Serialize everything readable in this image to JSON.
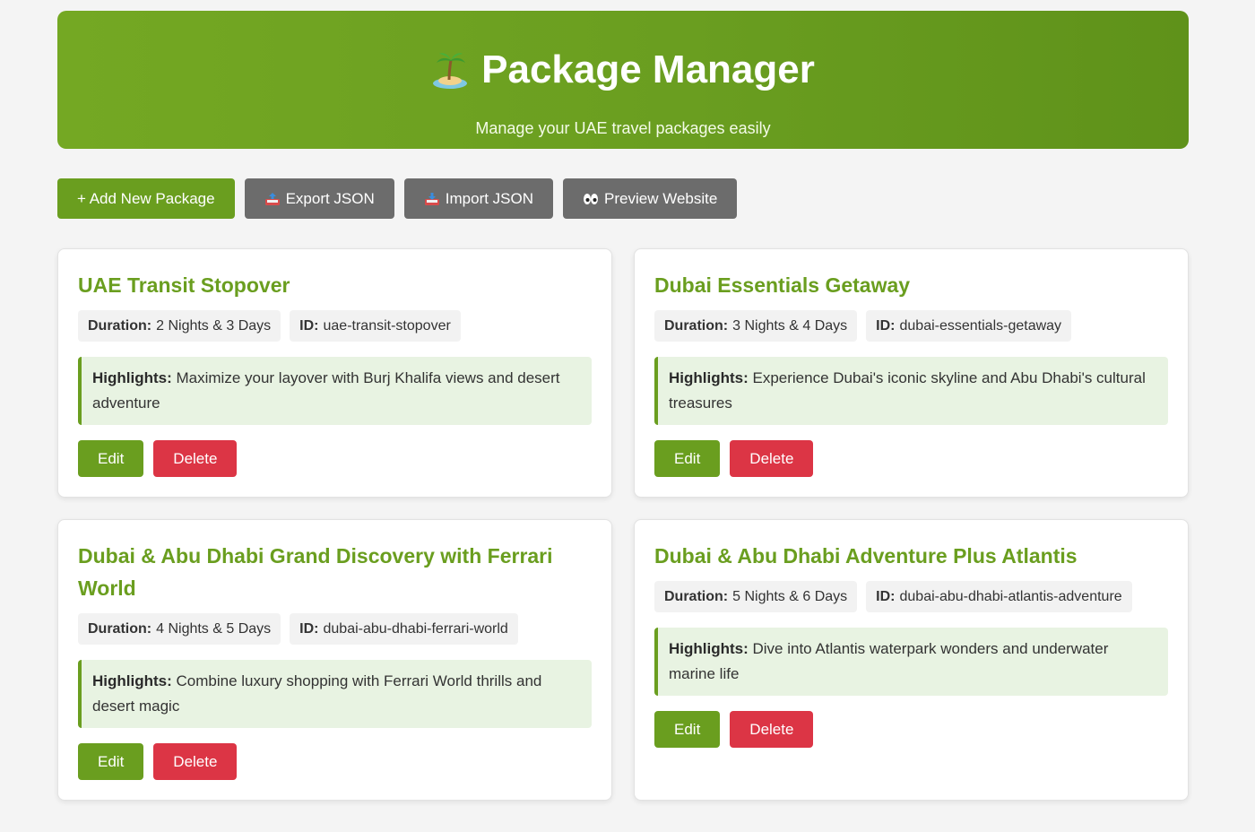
{
  "header": {
    "icon": "palm-island-icon",
    "title": "Package Manager",
    "subtitle": "Manage your UAE travel packages easily"
  },
  "toolbar": {
    "add_label": "+ Add New Package",
    "export_label": "Export JSON",
    "export_icon": "outbox-tray-icon",
    "import_label": "Import JSON",
    "import_icon": "inbox-tray-icon",
    "preview_label": "Preview Website",
    "preview_icon": "eyes-icon"
  },
  "labels": {
    "duration": "Duration:",
    "id": "ID:",
    "highlights": "Highlights:",
    "edit": "Edit",
    "delete": "Delete"
  },
  "packages": [
    {
      "title": "UAE Transit Stopover",
      "duration": "2 Nights & 3 Days",
      "id": "uae-transit-stopover",
      "highlights": "Maximize your layover with Burj Khalifa views and desert adventure"
    },
    {
      "title": "Dubai Essentials Getaway",
      "duration": "3 Nights & 4 Days",
      "id": "dubai-essentials-getaway",
      "highlights": "Experience Dubai's iconic skyline and Abu Dhabi's cultural treasures"
    },
    {
      "title": "Dubai & Abu Dhabi Grand Discovery with Ferrari World",
      "duration": "4 Nights & 5 Days",
      "id": "dubai-abu-dhabi-ferrari-world",
      "highlights": "Combine luxury shopping with Ferrari World thrills and desert magic"
    },
    {
      "title": "Dubai & Abu Dhabi Adventure Plus Atlantis",
      "duration": "5 Nights & 6 Days",
      "id": "dubai-abu-dhabi-atlantis-adventure",
      "highlights": "Dive into Atlantis waterpark wonders and underwater marine life"
    }
  ],
  "colors": {
    "primary": "#6a9e1f",
    "secondary": "#6c6c6c",
    "danger": "#dc3545",
    "highlight_bg": "#e8f3e2"
  }
}
